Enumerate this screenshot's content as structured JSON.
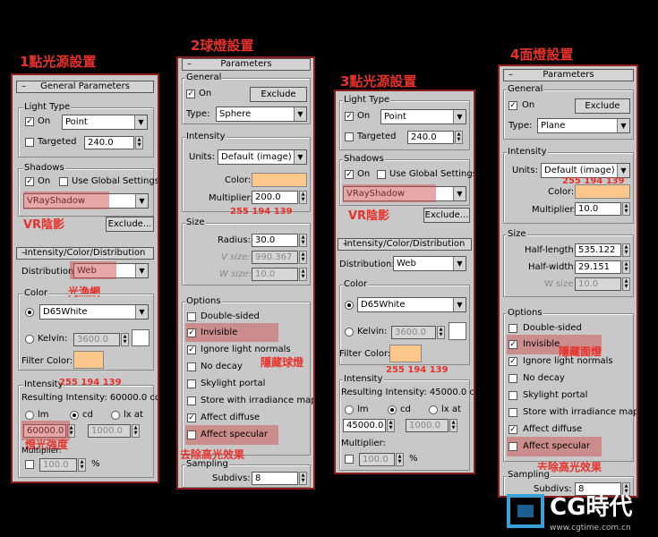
{
  "captions": {
    "c1": "1點光源設置",
    "c2": "2球燈設置",
    "c3": "3點光源設置",
    "c4": "4面燈設置"
  },
  "colors": {
    "annotation": "#e8312b",
    "swatch": "#fcc78b",
    "panel_border": "#8a1c1c"
  },
  "panel1": {
    "rollout_general": "General Parameters",
    "light_type": "Light Type",
    "on": "On",
    "type_value": "Point",
    "targeted": "Targeted",
    "targeted_value": "240.0",
    "shadows": "Shadows",
    "shadows_on": "On",
    "use_global": "Use Global Settings",
    "shadow_type": "VRayShadow",
    "exclude": "Exclude...",
    "rollout_intensity": "Intensity/Color/Distribution",
    "distribution": "Distribution:",
    "distribution_value": "Web",
    "color": "Color",
    "color_value": "D65White",
    "kelvin": "Kelvin:",
    "kelvin_value": "3600.0",
    "filter_color": "Filter Color:",
    "intensity": "Intensity",
    "resulting": "Resulting Intensity: 60000.0 cd",
    "lm": "lm",
    "cd": "cd",
    "lxat": "lx at",
    "value1": "60000.0",
    "value2": "1000.0",
    "multiplier": "Multiplier:",
    "mult_value": "100.0",
    "percent": "%",
    "ann_vr": "VR陰影",
    "ann_web": "光漁網",
    "ann_rgb": "255 194 139",
    "ann_strength": "燈光強度"
  },
  "panel2": {
    "rollout": "Parameters",
    "general": "General",
    "on": "On",
    "exclude": "Exclude",
    "type": "Type:",
    "type_value": "Sphere",
    "intensity": "Intensity",
    "units": "Units:",
    "units_value": "Default (image)",
    "color": "Color:",
    "multiplier": "Multiplier:",
    "mult_value": "200.0",
    "size": "Size",
    "radius": "Radius:",
    "radius_value": "30.0",
    "vsize": "V size:",
    "vsize_value": "990.367",
    "wsize": "W size:",
    "wsize_value": "10.0",
    "options": "Options",
    "double": "Double-sided",
    "invisible": "Invisible",
    "ignore": "Ignore light normals",
    "nodecay": "No decay",
    "skylight": "Skylight portal",
    "store": "Store with irradiance map",
    "diffuse": "Affect diffuse",
    "specular": "Affect specular",
    "sampling": "Sampling",
    "subdivs": "Subdivs:",
    "subdivs_value": "8",
    "ann_rgb": "255 194 139",
    "ann_hide": "隱藏球燈",
    "ann_remove": "去除高光效果"
  },
  "panel3": {
    "light_type": "Light Type",
    "on": "On",
    "type_value": "Point",
    "targeted": "Targeted",
    "targeted_value": "240.0",
    "shadows": "Shadows",
    "shadows_on": "On",
    "use_global": "Use Global Settings",
    "shadow_type": "VRayShadow",
    "exclude": "Exclude...",
    "rollout_intensity": "Intensity/Color/Distribution",
    "distribution": "Distribution:",
    "distribution_value": "Web",
    "color": "Color",
    "color_value": "D65White",
    "kelvin": "Kelvin:",
    "kelvin_value": "3600.0",
    "filter_color": "Filter Color:",
    "intensity": "Intensity",
    "resulting": "Resulting Intensity: 45000.0 cd",
    "lm": "lm",
    "cd": "cd",
    "lxat": "lx at",
    "value1": "45000.0",
    "value2": "1000.0",
    "multiplier": "Multiplier:",
    "mult_value": "100.0",
    "percent": "%",
    "ann_vr": "VR陰影",
    "ann_rgb": "255 194 139"
  },
  "panel4": {
    "rollout": "Parameters",
    "general": "General",
    "on": "On",
    "exclude": "Exclude",
    "type": "Type:",
    "type_value": "Plane",
    "intensity": "Intensity",
    "units": "Units:",
    "units_value": "Default (image)",
    "color": "Color:",
    "multiplier": "Multiplier:",
    "mult_value": "10.0",
    "size": "Size",
    "half_length": "Half-length:",
    "half_length_value": "535.122",
    "half_width": "Half-width:",
    "half_width_value": "29.151",
    "wsize": "W size",
    "wsize_value": "10.0",
    "options": "Options",
    "double": "Double-sided",
    "invisible": "Invisible",
    "ignore": "Ignore light normals",
    "nodecay": "No decay",
    "skylight": "Skylight portal",
    "store": "Store with irradiance map",
    "diffuse": "Affect diffuse",
    "specular": "Affect specular",
    "sampling": "Sampling",
    "subdivs": "Subdivs:",
    "subdivs_value": "8",
    "ann_rgb": "255 194 139",
    "ann_hide": "隱藏面燈",
    "ann_remove": "去除高光效果"
  },
  "logo": {
    "text": "CG時代",
    "url": "www.cgtime.com.cn"
  }
}
